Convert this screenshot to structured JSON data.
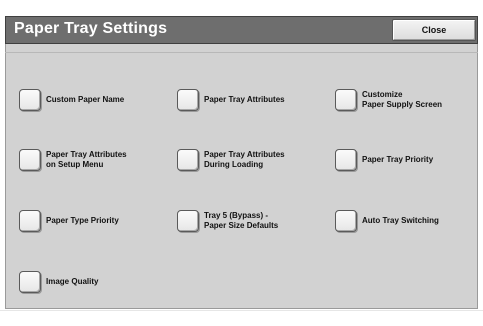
{
  "header": {
    "title": "Paper Tray Settings",
    "close_label": "Close"
  },
  "options": [
    {
      "label": "Custom Paper Name"
    },
    {
      "label": "Paper Tray Attributes"
    },
    {
      "label": "Customize\nPaper Supply Screen"
    },
    {
      "label": "Paper Tray Attributes\non Setup Menu"
    },
    {
      "label": "Paper Tray Attributes\nDuring Loading"
    },
    {
      "label": "Paper Tray Priority"
    },
    {
      "label": "Paper Type Priority"
    },
    {
      "label": "Tray 5 (Bypass) -\nPaper Size Defaults"
    },
    {
      "label": "Auto Tray Switching"
    },
    {
      "label": "Image Quality"
    }
  ]
}
